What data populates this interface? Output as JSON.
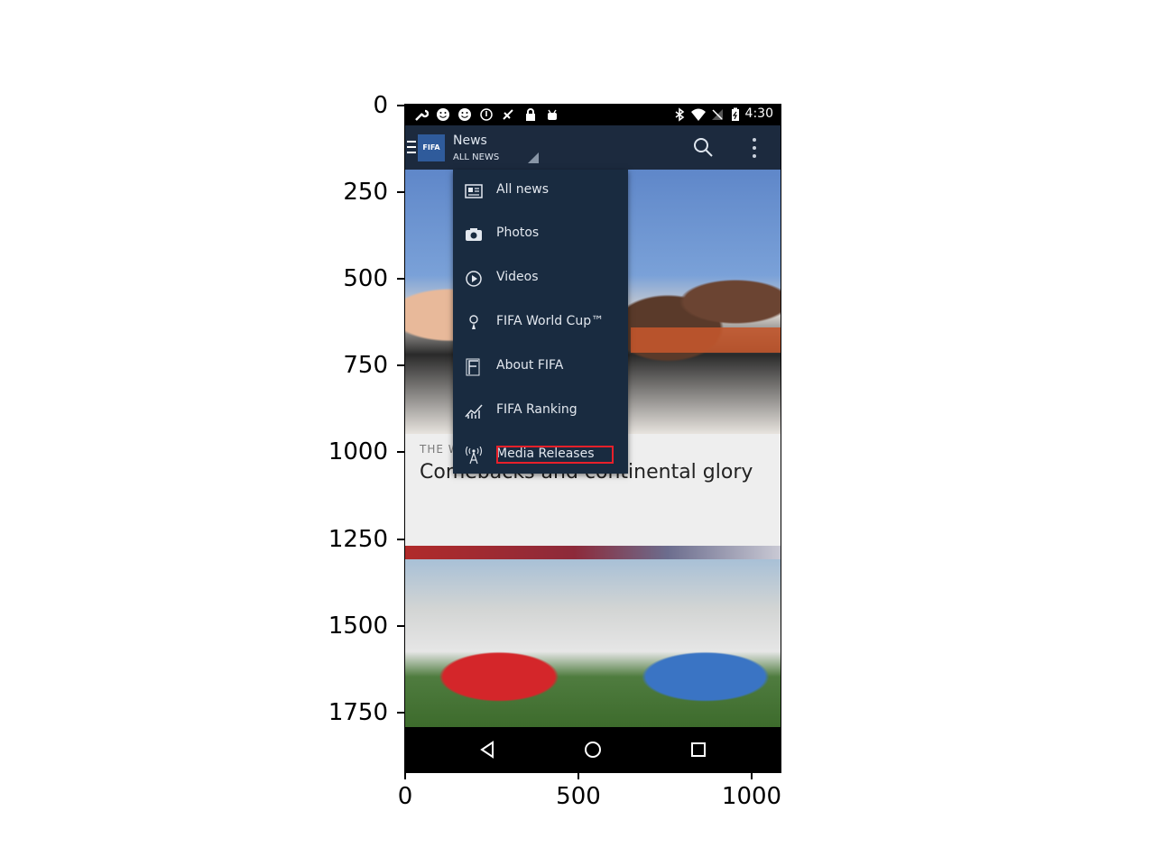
{
  "axes": {
    "y_ticks": [
      "0",
      "250",
      "500",
      "750",
      "1000",
      "1250",
      "1500",
      "1750"
    ],
    "x_ticks": [
      "0",
      "500",
      "1000"
    ]
  },
  "status_bar": {
    "time": "4:30",
    "icons": [
      "wrench-icon",
      "smiley-icon",
      "smiley-icon",
      "info-icon",
      "no-gps-icon",
      "lock-icon",
      "android-icon",
      "bluetooth-icon",
      "wifi-icon",
      "no-signal-icon",
      "battery-icon"
    ]
  },
  "toolbar": {
    "title": "News",
    "subtitle": "ALL NEWS",
    "logo_text": "FIFA"
  },
  "menu": {
    "items": [
      {
        "label": "All news",
        "icon": "newspaper-icon"
      },
      {
        "label": "Photos",
        "icon": "camera-icon"
      },
      {
        "label": "Videos",
        "icon": "play-icon"
      },
      {
        "label": "FIFA World Cup™",
        "icon": "trophy-icon"
      },
      {
        "label": "About FIFA",
        "icon": "fifa-f-icon"
      },
      {
        "label": "FIFA Ranking",
        "icon": "chart-icon"
      },
      {
        "label": "Media Releases",
        "icon": "antenna-icon"
      }
    ]
  },
  "card": {
    "kicker": "THE W",
    "title": "Comebacks and continental glory"
  },
  "colors": {
    "toolbar": "#1c2a3e",
    "menu": "#192b40",
    "highlight": "#e8202a"
  }
}
